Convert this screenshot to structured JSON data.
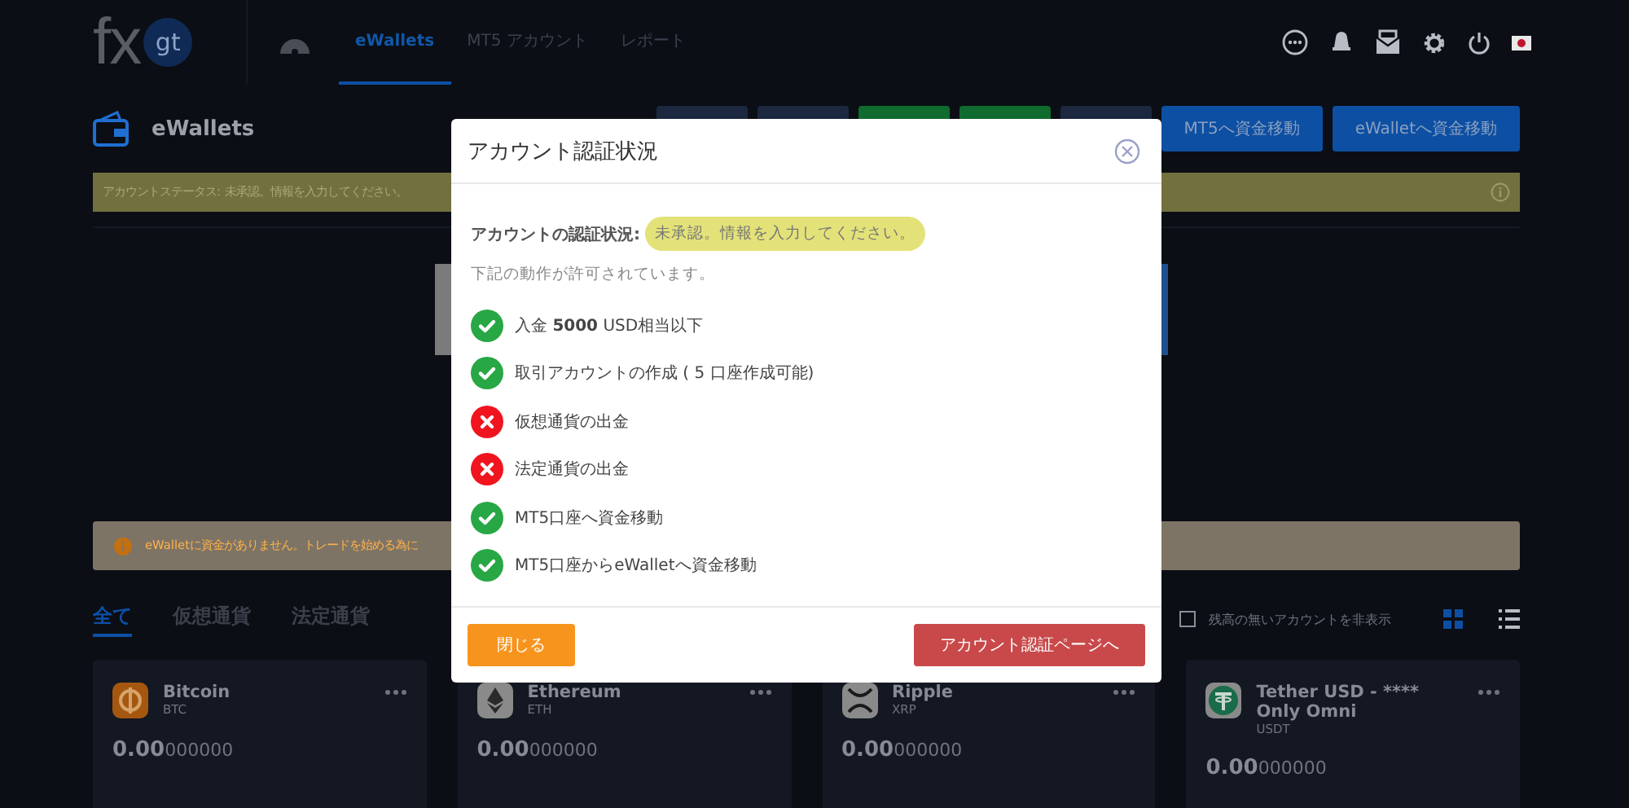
{
  "logo": {
    "text": "fx",
    "badge": "gt"
  },
  "nav": {
    "tabs": [
      {
        "label": "eWallets",
        "selected": true
      },
      {
        "label": "MT5 アカウント",
        "selected": false
      },
      {
        "label": "レポート",
        "selected": false
      }
    ]
  },
  "header": {
    "title": "eWallets",
    "buttons": [
      {
        "kind": "covered",
        "color": "#1c2740"
      },
      {
        "kind": "covered",
        "color": "#1c2740"
      },
      {
        "kind": "covered",
        "color": "#0f6b2e"
      },
      {
        "kind": "covered",
        "color": "#0f6b2e"
      },
      {
        "kind": "covered",
        "color": "#1c2740"
      },
      {
        "kind": "labeled",
        "color": "#0d4fa3",
        "label": "MT5へ資金移動"
      },
      {
        "kind": "labeled",
        "color": "#0d4fa3",
        "label": "eWalletへ資金移動"
      }
    ]
  },
  "status_alert": {
    "text": "アカウントステータス: 未承認。情報を入力してください。"
  },
  "funds_alert": {
    "text": "eWalletに資金がありません。トレードを始める為に"
  },
  "filter_tabs": [
    {
      "label": "全て",
      "selected": true
    },
    {
      "label": "仮想通貨",
      "selected": false
    },
    {
      "label": "法定通貨",
      "selected": false
    }
  ],
  "hide_empty": {
    "label": "残高の無いアカウントを非表示",
    "checked": false
  },
  "view_modes": [
    {
      "kind": "grid",
      "selected": true
    },
    {
      "kind": "list",
      "selected": false
    }
  ],
  "wallets": [
    {
      "kind": "btc",
      "name": "Bitcoin",
      "code": "BTC",
      "balance_main": "0.00",
      "balance_rest": "000000"
    },
    {
      "kind": "eth",
      "name": "Ethereum",
      "code": "ETH",
      "balance_main": "0.00",
      "balance_rest": "000000"
    },
    {
      "kind": "xrp",
      "name": "Ripple",
      "code": "XRP",
      "balance_main": "0.00",
      "balance_rest": "000000"
    },
    {
      "kind": "usdt",
      "name": "Tether USD - **** Only Omni",
      "code": "USDT",
      "balance_main": "0.00",
      "balance_rest": "000000"
    }
  ],
  "modal": {
    "title": "アカウント認証状況",
    "status_label": "アカウントの認証状況:",
    "status_badge": "未承認。情報を入力してください。",
    "intro": "下記の動作が許可されています。",
    "permissions": [
      {
        "text": "入金 **5000** USD相当以下",
        "allowed": true
      },
      {
        "text": "取引アカウントの作成 ( 5 口座作成可能)",
        "allowed": true
      },
      {
        "text": "仮想通貨の出金",
        "allowed": false
      },
      {
        "text": "法定通貨の出金",
        "allowed": false
      },
      {
        "text": "MT5口座へ資金移動",
        "allowed": true
      },
      {
        "text": "MT5口座からeWalletへ資金移動",
        "allowed": true
      }
    ],
    "close_button": "閉じる",
    "verify_button": "アカウント認証ページへ"
  }
}
